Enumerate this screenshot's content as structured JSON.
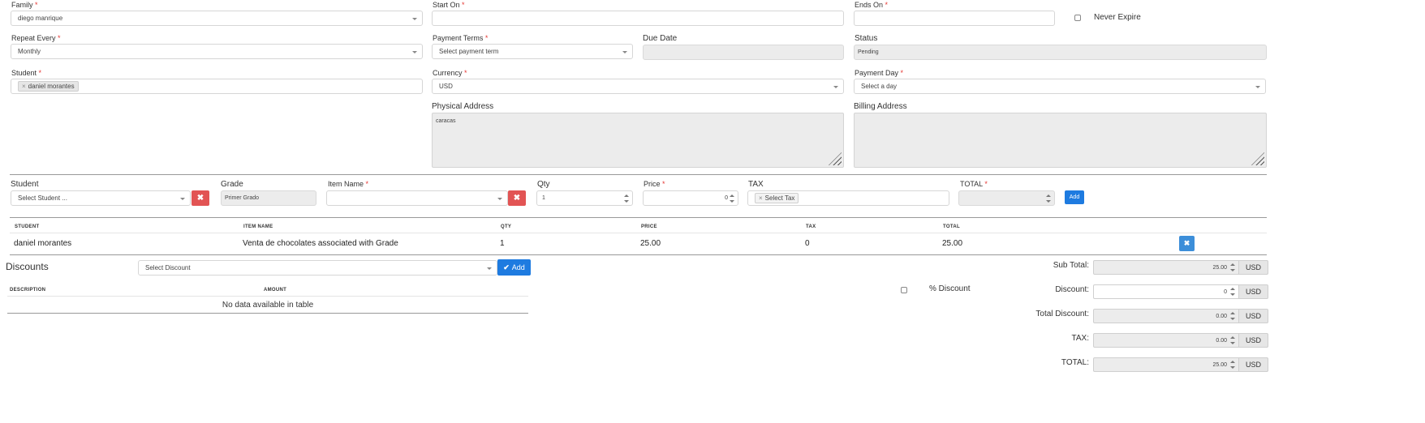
{
  "invoice": {
    "family": {
      "label": "Family",
      "value": "diego manrique"
    },
    "start_on": {
      "label": "Start On",
      "value": ""
    },
    "ends_on": {
      "label": "Ends On",
      "value": ""
    },
    "never_expire": {
      "label": "Never Expire",
      "checked": false
    },
    "repeat_every": {
      "label": "Repeat Every",
      "value": "Monthly"
    },
    "payment_terms": {
      "label": "Payment Terms",
      "value": "Select payment term"
    },
    "due_date": {
      "label": "Due Date",
      "value": ""
    },
    "status": {
      "label": "Status",
      "value": "Pending"
    },
    "student": {
      "label": "Student",
      "tags": [
        "daniel morantes"
      ]
    },
    "currency": {
      "label": "Currency",
      "value": "USD"
    },
    "payment_day": {
      "label": "Payment Day",
      "value": "Select a day"
    },
    "physical_address": {
      "label": "Physical Address",
      "value": "caracas"
    },
    "billing_address": {
      "label": "Billing Address",
      "value": ""
    },
    "required_mark": "*"
  },
  "item_entry": {
    "student": {
      "label": "Student",
      "placeholder": "Select Student ..."
    },
    "grade": {
      "label": "Grade",
      "value": "Primer Grado"
    },
    "item_name": {
      "label": "Item Name",
      "value": ""
    },
    "qty": {
      "label": "Qty",
      "value": "1"
    },
    "price": {
      "label": "Price",
      "value": "0"
    },
    "tax": {
      "label": "TAX",
      "tags": [
        "Select Tax"
      ]
    },
    "total": {
      "label": "TOTAL",
      "value": ""
    },
    "add_label": "Add",
    "remove_glyph": "✖"
  },
  "items_table": {
    "headers": [
      "STUDENT",
      "ITEM NAME",
      "QTY",
      "PRICE",
      "TAX",
      "TOTAL"
    ],
    "rows": [
      [
        "daniel morantes",
        "Venta de chocolates associated with Grade",
        "1",
        "25.00",
        "0",
        "25.00"
      ]
    ],
    "row_remove_glyph": "✖"
  },
  "discounts": {
    "title": "Discounts",
    "select_placeholder": "Select Discount",
    "add_label": "Add",
    "headers": [
      "DESCRIPTION",
      "AMOUNT"
    ],
    "empty_text": "No data available in table",
    "percent_label": "% Discount"
  },
  "summary": {
    "currency_code": "USD",
    "rows": [
      {
        "label": "Sub Total:",
        "value": "25.00"
      },
      {
        "label": "Discount:",
        "value": "0"
      },
      {
        "label": "Total Discount:",
        "value": "0.00"
      },
      {
        "label": "TAX:",
        "value": "0.00"
      },
      {
        "label": "TOTAL:",
        "value": "25.00"
      }
    ]
  },
  "colors": {
    "primary": "#1e7be0",
    "danger": "#e25454",
    "required": "#e53935",
    "readonly_bg": "#ececec"
  }
}
